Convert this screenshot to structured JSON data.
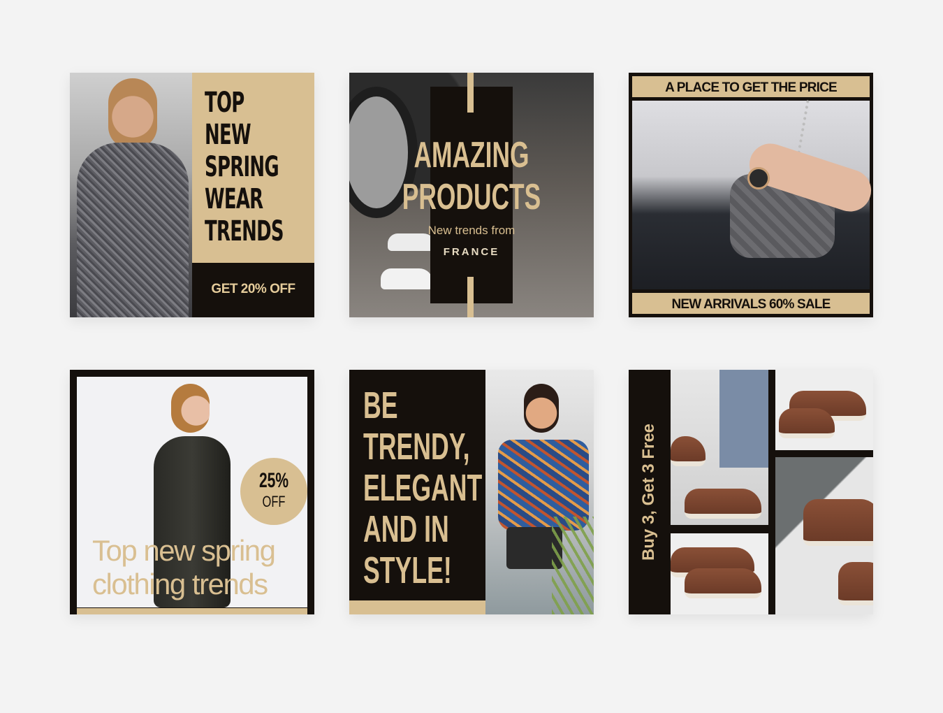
{
  "cards": [
    {
      "title": "TOP\nNEW\nSPRING\nWEAR\nTRENDS",
      "cta": "GET 20% OFF"
    },
    {
      "title": "AMAZING\nPRODUCTS",
      "subtitle": "New trends from",
      "location": "FRANCE"
    },
    {
      "top_band": "A PLACE TO GET THE PRICE",
      "bottom_band": "NEW ARRIVALS 60% SALE"
    },
    {
      "badge_percent": "25%",
      "badge_label": "OFF",
      "headline": "Top new spring\nclothing trends"
    },
    {
      "title": "BE\nTRENDY,\nELEGANT\nAND IN\nSTYLE!"
    },
    {
      "vertical_text": "Buy 3, Get 3 Free"
    }
  ],
  "colors": {
    "background": "#f3f3f3",
    "tan": "#d8bf92",
    "dark": "#15100c"
  }
}
